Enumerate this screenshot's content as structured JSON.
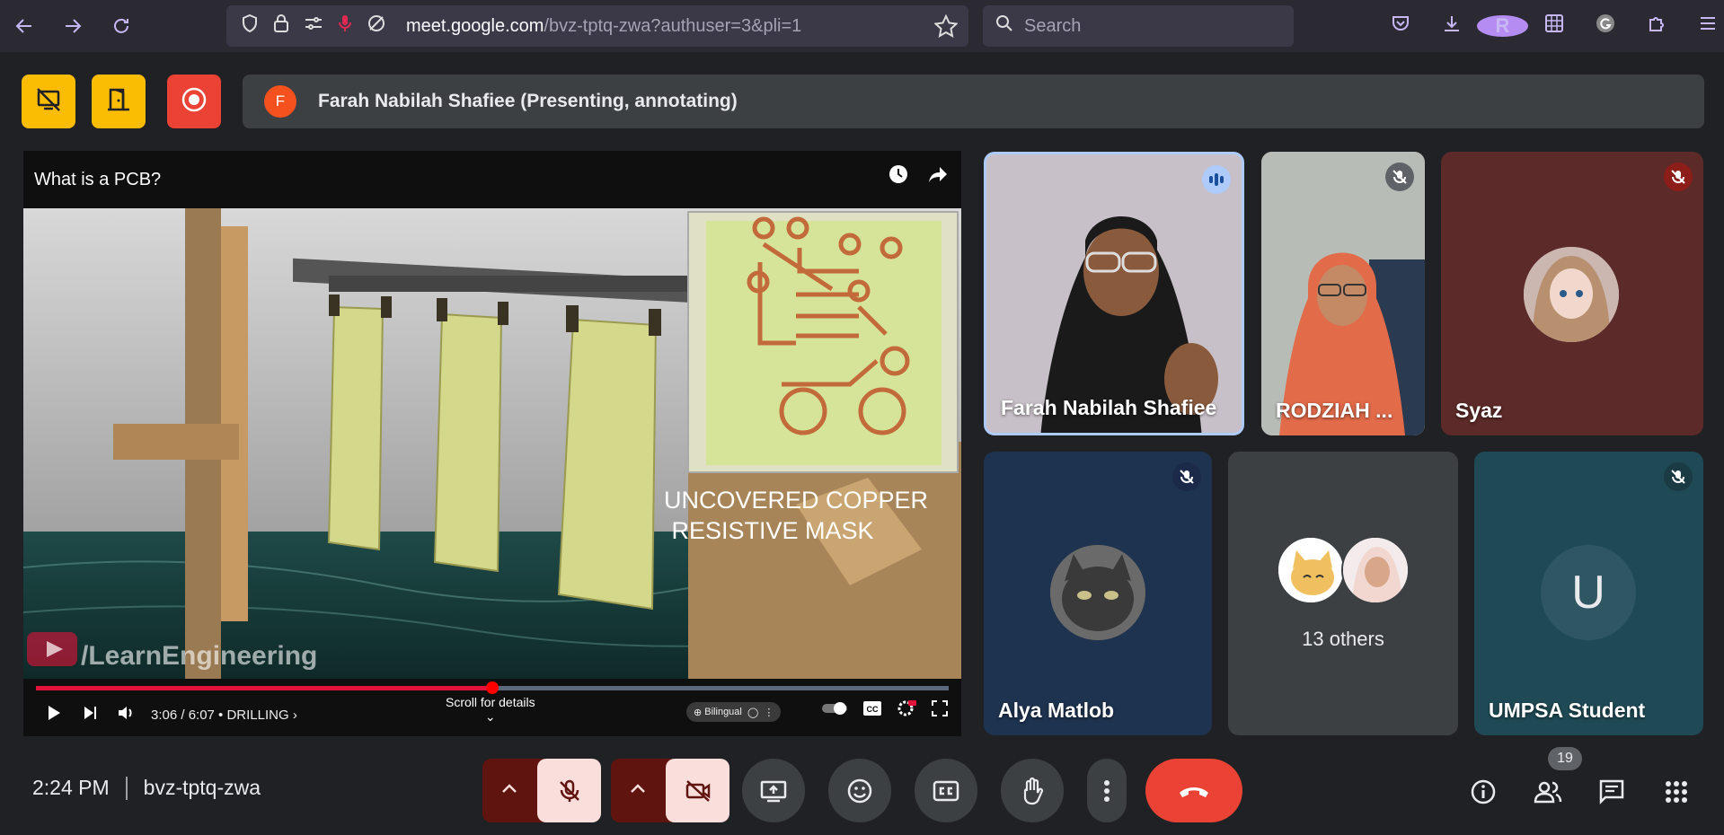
{
  "browser": {
    "url_host": "meet.google.com",
    "url_path": "/bvz-tptq-zwa?authuser=3&pli=1",
    "search_placeholder": "Search",
    "profile_initial": "R"
  },
  "meet": {
    "presenter_initial": "F",
    "presenter_label": "Farah Nabilah Shafiee (Presenting, annotating)"
  },
  "video": {
    "title": "What is a PCB?",
    "overlay_text_line1": "UNCOVERED COPPER",
    "overlay_text_line2": "RESISTIVE MASK",
    "watermark": "/LearnEngineering",
    "time": "3:06 / 6:07 • DRILLING ›",
    "scroll_hint": "Scroll for details",
    "bilingual_label": "Bilingual",
    "progress": 0.5
  },
  "participants": {
    "p1_name": "Farah Nabilah Shafiee",
    "p2_name": "RODZIAH ...",
    "p3_name": "Syaz",
    "p4_name": "Alya Matlob",
    "others_label": "13 others",
    "p5_name": "UMPSA Student",
    "p5_initial": "U"
  },
  "footer": {
    "time": "2:24 PM",
    "meeting_code": "bvz-tptq-zwa",
    "people_count": "19"
  },
  "colors": {
    "accent_yellow": "#fbbc04",
    "accent_red": "#ea4335",
    "pink_off": "#f9dedc",
    "dark_red": "#601410"
  }
}
